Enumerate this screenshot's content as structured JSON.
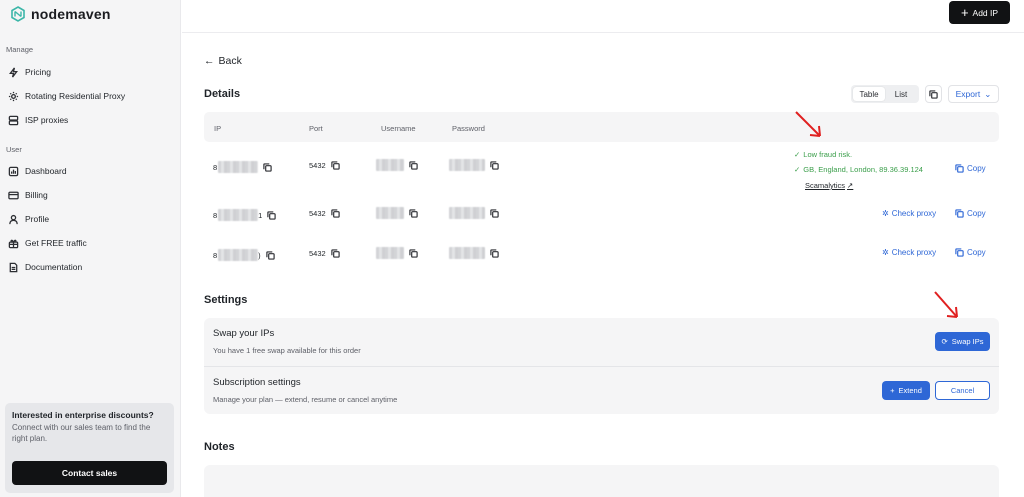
{
  "app": {
    "logo_text": "nodemaven"
  },
  "sidebar": {
    "manage_label": "Manage",
    "manage_items": [
      {
        "label": "Pricing",
        "icon": "bolt-icon"
      },
      {
        "label": "Rotating Residential Proxy",
        "icon": "gear-icon"
      },
      {
        "label": "ISP proxies",
        "icon": "server-icon"
      }
    ],
    "user_label": "User",
    "user_items": [
      {
        "label": "Dashboard",
        "icon": "chart-icon"
      },
      {
        "label": "Billing",
        "icon": "card-icon"
      },
      {
        "label": "Profile",
        "icon": "user-icon"
      },
      {
        "label": "Get FREE traffic",
        "icon": "gift-icon"
      },
      {
        "label": "Documentation",
        "icon": "document-icon"
      }
    ],
    "promo": {
      "title": "Interested in enterprise discounts?",
      "text": "Connect with our sales team to find the right plan.",
      "button": "Contact sales"
    }
  },
  "topbar": {
    "add_ip_label": "Add IP"
  },
  "main": {
    "back_label": "Back",
    "details_heading": "Details",
    "view_toggle": {
      "table": "Table",
      "list": "List",
      "active": "Table"
    },
    "export_label": "Export",
    "columns": [
      "IP",
      "Port",
      "Username",
      "Password"
    ],
    "rows": [
      {
        "ip_prefix": "8",
        "ip_suffix": "",
        "port": "5432",
        "fraud_risk": "Low fraud risk.",
        "location": "GB, England, London, 89.36.39.124",
        "scam_link": "Scamalytics",
        "copy_label": "Copy"
      },
      {
        "ip_prefix": "8",
        "ip_suffix": "1",
        "port": "5432",
        "check_label": "Check proxy",
        "copy_label": "Copy"
      },
      {
        "ip_prefix": "8",
        "ip_suffix": ")",
        "port": "5432",
        "check_label": "Check proxy",
        "copy_label": "Copy"
      }
    ],
    "settings_heading": "Settings",
    "swap": {
      "title": "Swap your IPs",
      "subtitle": "You have 1 free swap available for this order",
      "button": "Swap IPs"
    },
    "subscription": {
      "title": "Subscription settings",
      "subtitle": "Manage your plan — extend, resume or cancel anytime",
      "extend_button": "Extend",
      "cancel_button": "Cancel"
    },
    "notes_heading": "Notes"
  },
  "colors": {
    "accent": "#2e67d6",
    "success": "#3a9e4a",
    "dark_button": "#111214",
    "annotation_arrow": "#e02020"
  }
}
